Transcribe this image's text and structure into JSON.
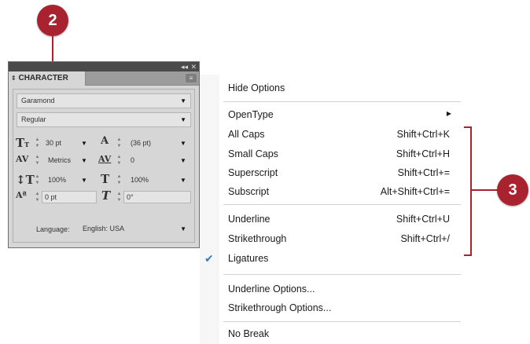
{
  "callouts": {
    "step_left": "2",
    "step_right": "3"
  },
  "panel": {
    "title": "CHARACTER",
    "font_family": "Garamond",
    "font_style": "Regular",
    "font_size": "30 pt",
    "leading": "(36 pt)",
    "kerning": "Metrics",
    "tracking": "0",
    "vertical_scale": "100%",
    "horizontal_scale": "100%",
    "baseline_shift": "0 pt",
    "skew": "0°",
    "language_label": "Language:",
    "language_value": "English: USA"
  },
  "menu": {
    "hide_options": "Hide Options",
    "opentype": "OpenType",
    "all_caps": "All Caps",
    "all_caps_sc": "Shift+Ctrl+K",
    "small_caps": "Small Caps",
    "small_caps_sc": "Shift+Ctrl+H",
    "superscript": "Superscript",
    "superscript_sc": "Shift+Ctrl+=",
    "subscript": "Subscript",
    "subscript_sc": "Alt+Shift+Ctrl+=",
    "underline": "Underline",
    "underline_sc": "Shift+Ctrl+U",
    "strikethrough": "Strikethrough",
    "strikethrough_sc": "Shift+Ctrl+/",
    "ligatures": "Ligatures",
    "underline_options": "Underline Options...",
    "strikethrough_options": "Strikethrough Options...",
    "no_break": "No Break"
  },
  "colors": {
    "callout": "#a8232f",
    "check": "#3b78c4"
  }
}
